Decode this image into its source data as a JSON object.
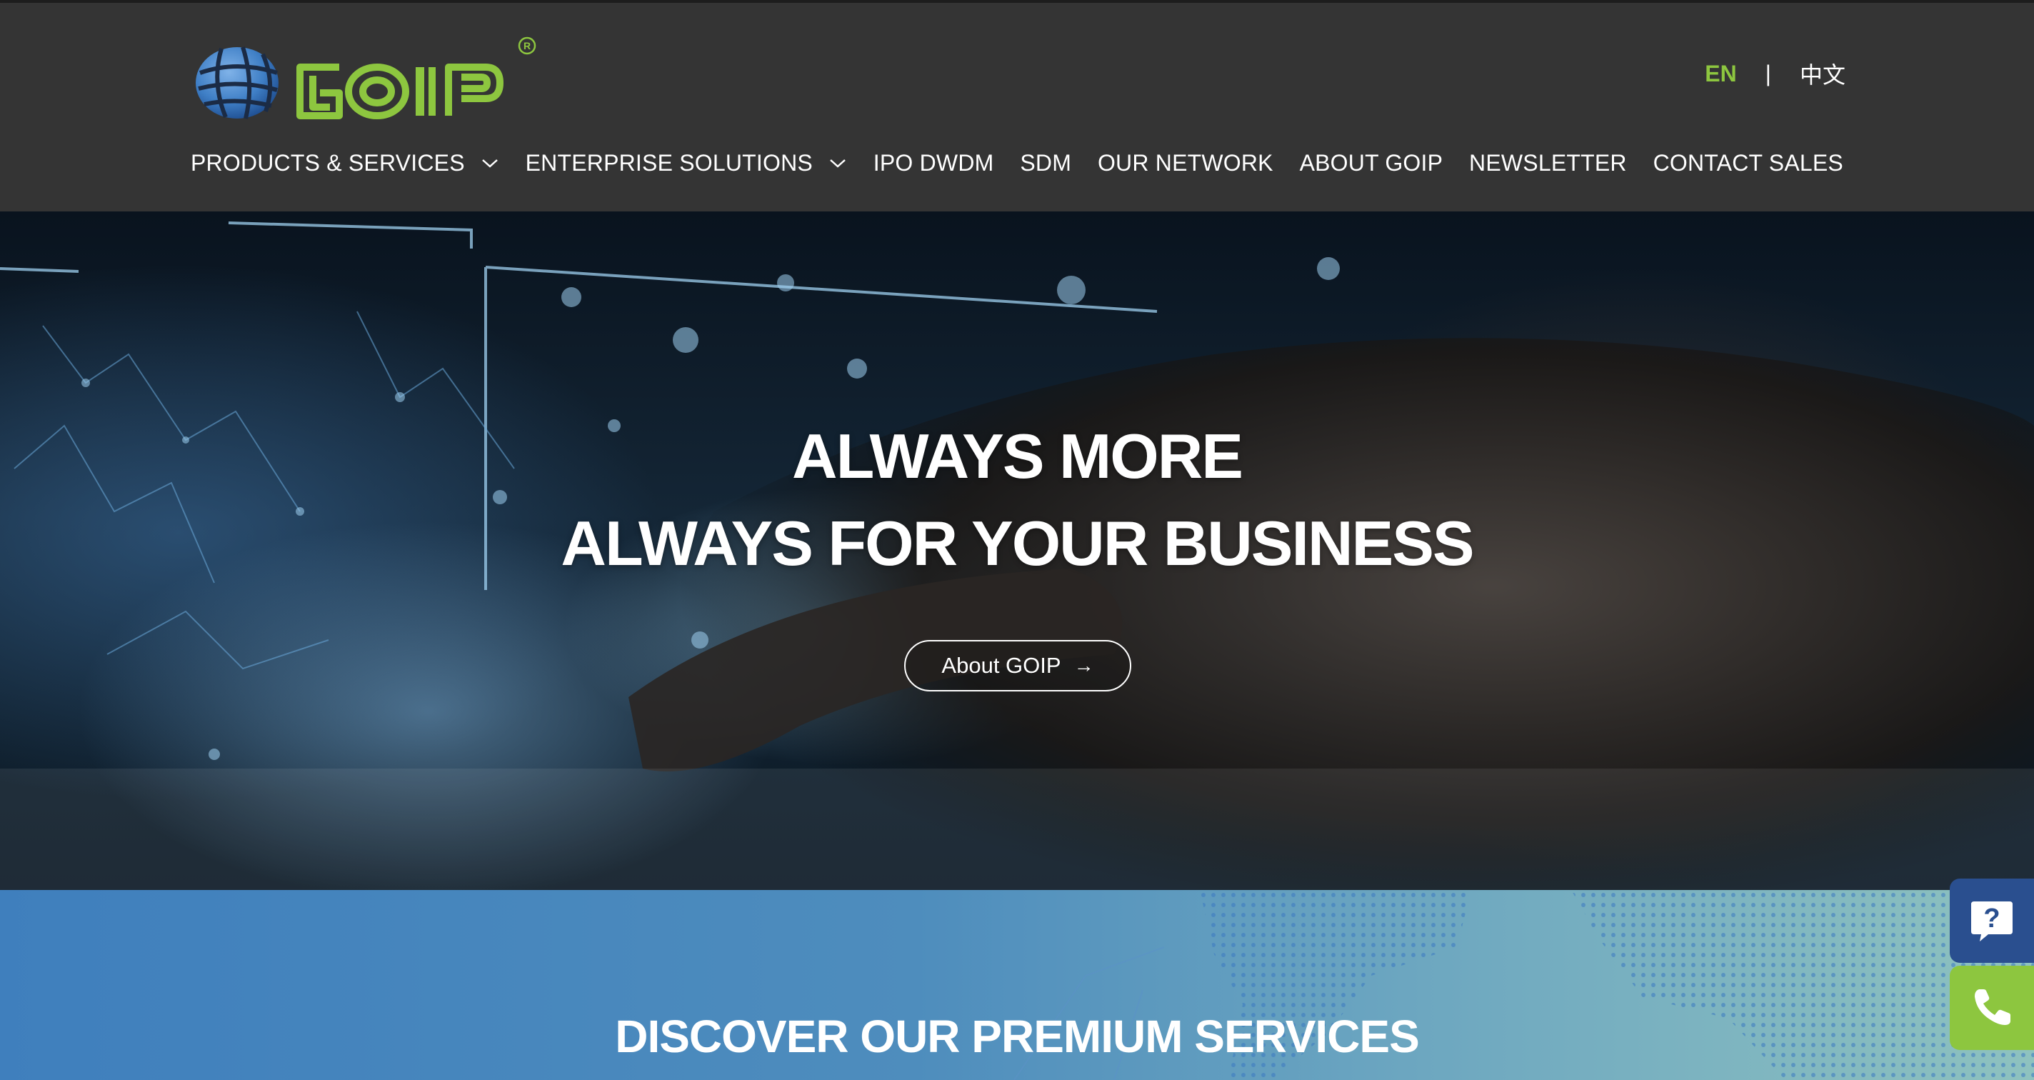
{
  "brand": {
    "name": "GOIP",
    "registered_mark": "®",
    "logo_icon": "globe-icon",
    "colors": {
      "green": "#8dc63f",
      "globe_blue": "#3f7fc6",
      "header_bg": "#343434"
    }
  },
  "language": {
    "en": "EN",
    "separator": "|",
    "zh": "中文"
  },
  "nav": {
    "products": "PRODUCTS & SERVICES",
    "enterprise": "ENTERPRISE SOLUTIONS",
    "ipo_dwdm": "IPO DWDM",
    "sdm": "SDM",
    "network": "OUR NETWORK",
    "about": "ABOUT GOIP",
    "newsletter": "NEWSLETTER",
    "contact": "CONTACT SALES"
  },
  "hero": {
    "line1": "ALWAYS MORE",
    "line2": "ALWAYS FOR YOUR BUSINESS",
    "button_label": "About GOIP",
    "button_icon": "arrow-right-icon"
  },
  "services": {
    "title": "DISCOVER OUR PREMIUM SERVICES"
  },
  "floating": {
    "help_icon": "question-chat-icon",
    "phone_icon": "phone-icon"
  }
}
